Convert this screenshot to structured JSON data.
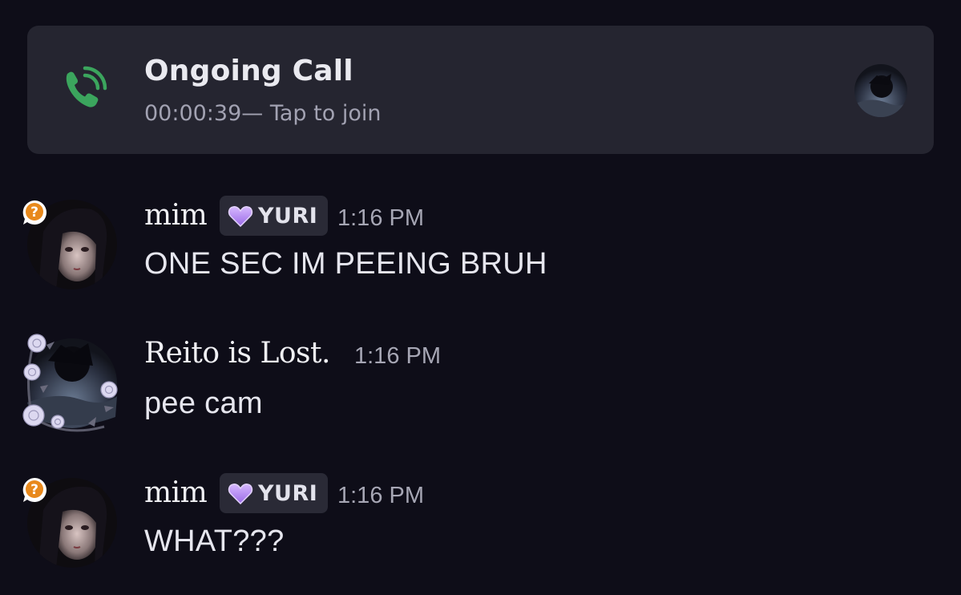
{
  "call": {
    "title": "Ongoing Call",
    "subtitle": "00:00:39— Tap to join",
    "accent": "#3ba55d"
  },
  "messages": [
    {
      "username": "mim",
      "tag": "YURI",
      "tag_icon": "purple-heart-icon",
      "timestamp": "1:16 PM",
      "text": "ONE SEC IM PEEING BRUH",
      "status_icon": "question-bubble-icon"
    },
    {
      "username": "Reito is Lost.",
      "timestamp": "1:16 PM",
      "text": "pee cam",
      "avatar_decoration": "rose-frame"
    },
    {
      "username": "mim",
      "tag": "YURI",
      "tag_icon": "purple-heart-icon",
      "timestamp": "1:16 PM",
      "text": "WHAT???",
      "status_icon": "question-bubble-icon"
    }
  ],
  "colors": {
    "background": "#0e0d18",
    "banner": "#252530",
    "tag_heart": "#b48cf0"
  }
}
